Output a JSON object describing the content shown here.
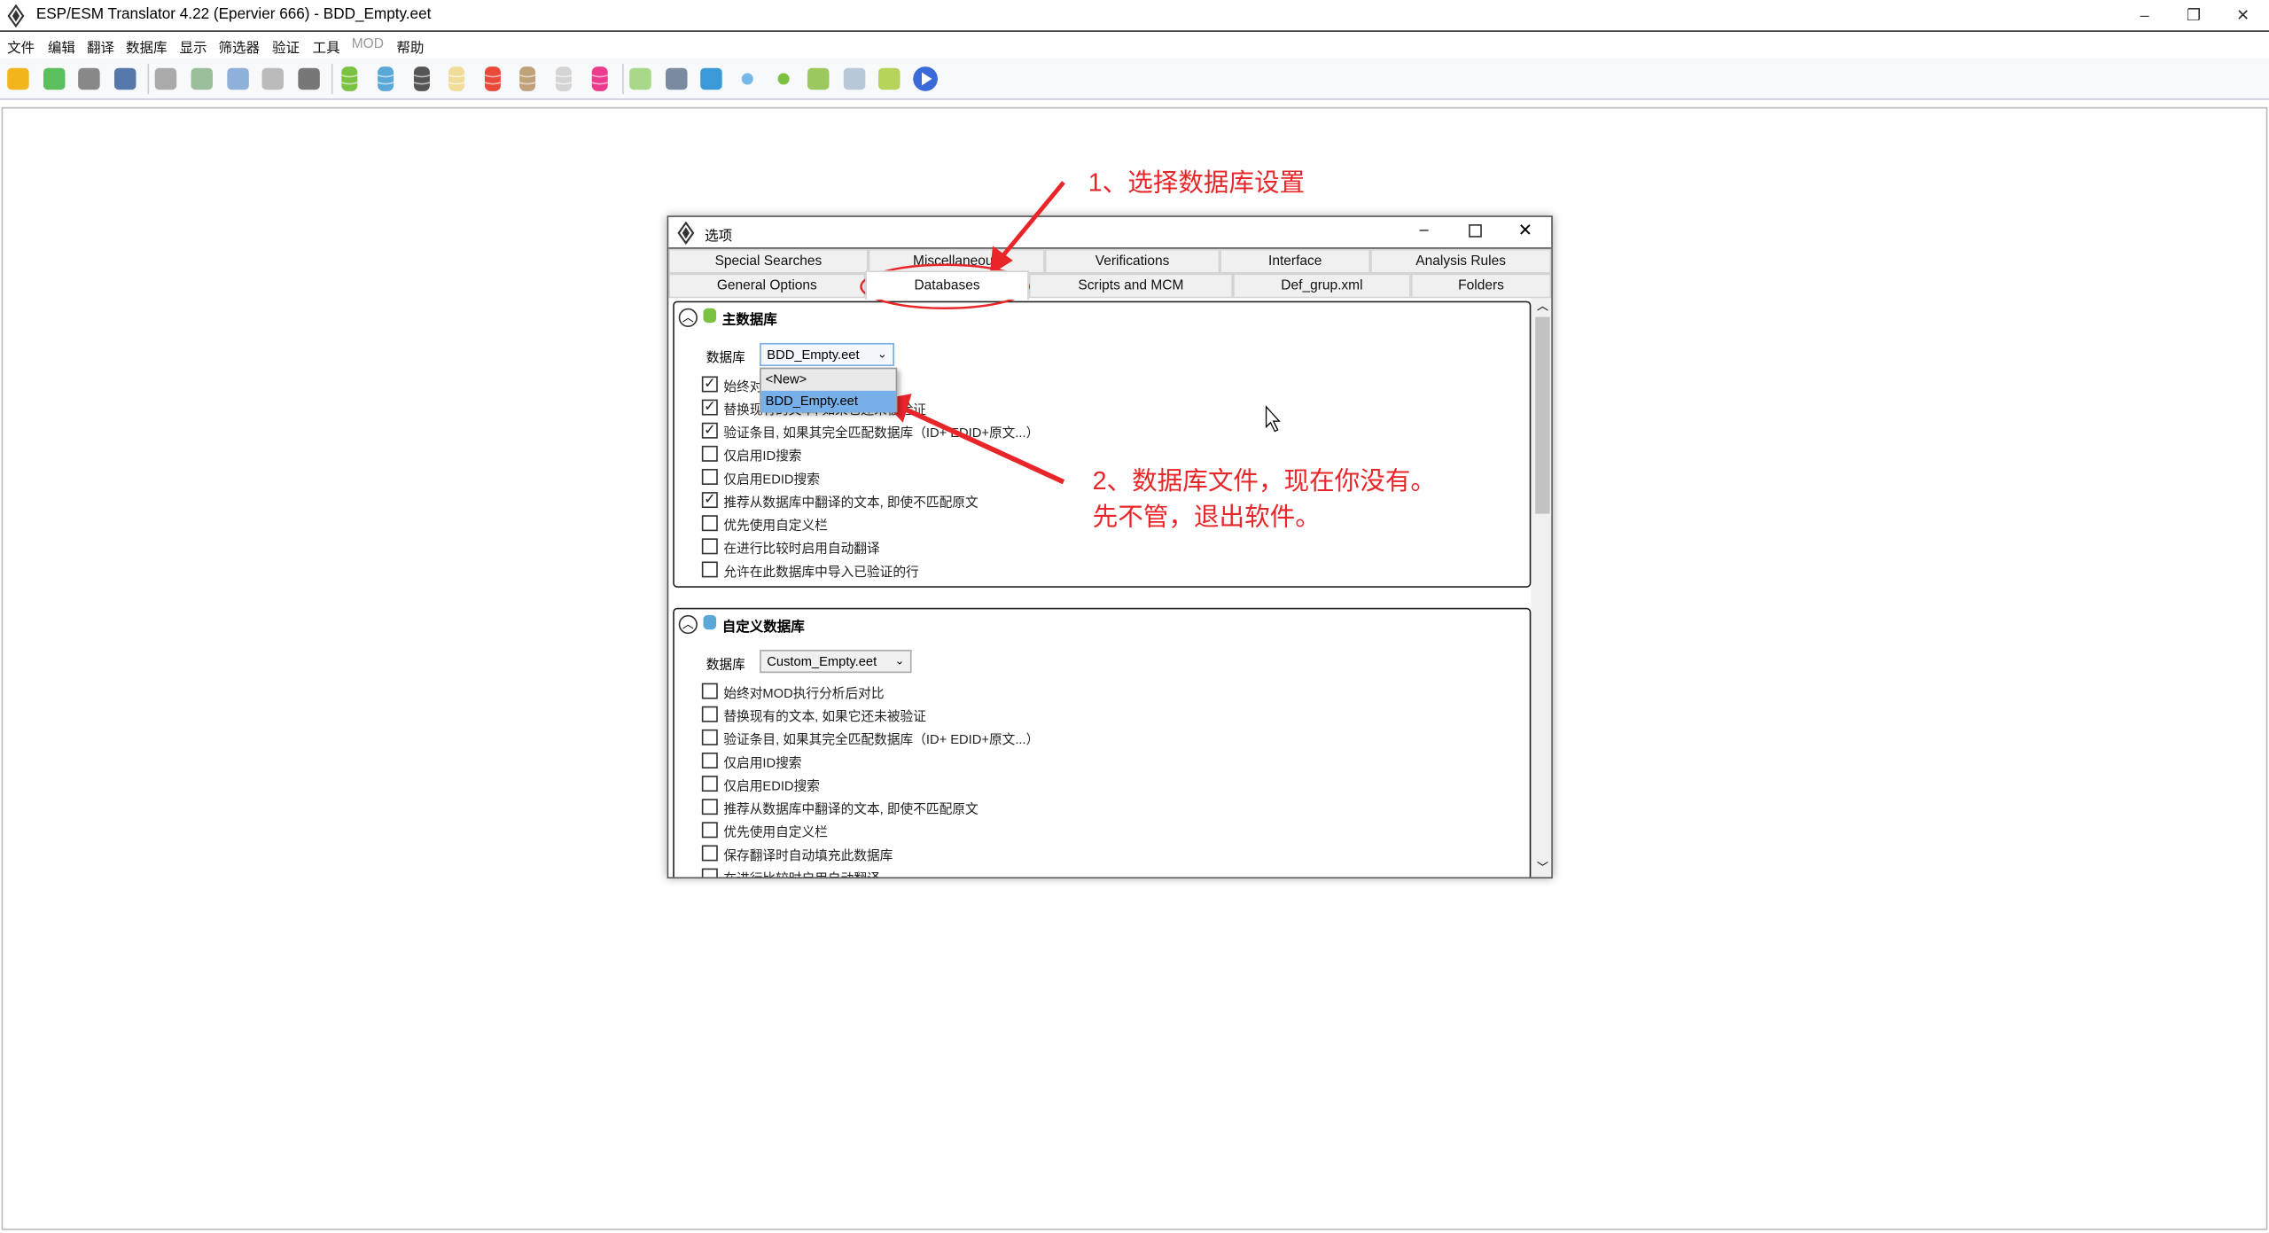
{
  "window": {
    "title": "ESP/ESM Translator 4.22 (Epervier 666) - BDD_Empty.eet",
    "controls": [
      "–",
      "❐",
      "✕"
    ]
  },
  "menu": [
    "文件",
    "编辑",
    "翻译",
    "数据库",
    "显示",
    "筛选器",
    "验证",
    "工具",
    "MOD",
    "帮助"
  ],
  "toolbar": [
    {
      "name": "open-folder-icon",
      "color": "#f2b51c"
    },
    {
      "name": "go-icon",
      "color": "#5bbf5b"
    },
    {
      "name": "gear-icon",
      "color": "#888888"
    },
    {
      "name": "edit-grid-icon",
      "color": "#5577aa"
    },
    {
      "sep": true
    },
    {
      "name": "search-icon",
      "color": "#aaaaaa"
    },
    {
      "name": "import-icon",
      "color": "#9bbf9b"
    },
    {
      "name": "export-icon",
      "color": "#8fb0d8"
    },
    {
      "name": "db-upload-icon",
      "color": "#bbbbbb"
    },
    {
      "name": "db-add-icon",
      "color": "#777777"
    },
    {
      "sep": true
    },
    {
      "name": "db-green-icon",
      "color": "#7cc242",
      "db": true
    },
    {
      "name": "db-blue-icon",
      "color": "#5aa8d8",
      "db": true
    },
    {
      "name": "db-black-icon",
      "color": "#555555",
      "db": true
    },
    {
      "name": "db-cream-icon",
      "color": "#f2dc9a",
      "db": true
    },
    {
      "name": "db-red-icon",
      "color": "#ea4a3a",
      "db": true
    },
    {
      "name": "db-tan-icon",
      "color": "#bfa27a",
      "db": true
    },
    {
      "name": "db-gray-icon",
      "color": "#d4d4d4",
      "db": true
    },
    {
      "name": "db-pink-icon",
      "color": "#ec3a8c",
      "db": true
    },
    {
      "sep": true
    },
    {
      "name": "script-icon",
      "color": "#a8d88a"
    },
    {
      "name": "wizard-icon",
      "color": "#7a8aa0"
    },
    {
      "name": "spellcheck-icon",
      "color": "#3a9ad8"
    },
    {
      "name": "dot-blue-icon",
      "color": "#77b8ea",
      "dot": true
    },
    {
      "name": "dot-green-icon",
      "color": "#7cc242",
      "dot": true
    },
    {
      "name": "xml-icon",
      "color": "#9cc860"
    },
    {
      "name": "book-icon",
      "color": "#b8c8d8"
    },
    {
      "name": "cube-icon",
      "color": "#b6d45a"
    },
    {
      "name": "play-icon",
      "color": "#3a6ad8",
      "round": true
    }
  ],
  "dialog": {
    "title": "选项",
    "tabs_row1": [
      "Special Searches",
      "Miscellaneous",
      "Verifications",
      "Interface",
      "Analysis Rules"
    ],
    "tabs_row2": [
      "General Options",
      "Databases",
      "Scripts and MCM",
      "Def_grup.xml",
      "Folders"
    ],
    "selected_tab": "Databases",
    "main_db": {
      "title": "主数据库",
      "db_label": "数据库",
      "value": "BDD_Empty.eet",
      "dropdown_options": [
        "<New>",
        "BDD_Empty.eet"
      ],
      "highlighted": "BDD_Empty.eet",
      "options": [
        {
          "label": "始终对MOD执行分析后对比",
          "checked": true
        },
        {
          "label": "替换现有的文本, 如果它还未被验证",
          "checked": true
        },
        {
          "label": "验证条目, 如果其完全匹配数据库（ID+ EDID+原文...）",
          "checked": true
        },
        {
          "label": "仅启用ID搜索",
          "checked": false
        },
        {
          "label": "仅启用EDID搜索",
          "checked": false
        },
        {
          "label": "推荐从数据库中翻译的文本, 即使不匹配原文",
          "checked": true
        },
        {
          "label": "优先使用自定义栏",
          "checked": false
        },
        {
          "label": "在进行比较时启用自动翻译",
          "checked": false
        },
        {
          "label": "允许在此数据库中导入已验证的行",
          "checked": false
        }
      ]
    },
    "custom_db": {
      "title": "自定义数据库",
      "db_label": "数据库",
      "value": "Custom_Empty.eet",
      "options": [
        {
          "label": "始终对MOD执行分析后对比",
          "checked": false
        },
        {
          "label": "替换现有的文本, 如果它还未被验证",
          "checked": false
        },
        {
          "label": "验证条目, 如果其完全匹配数据库（ID+ EDID+原文...）",
          "checked": false
        },
        {
          "label": "仅启用ID搜索",
          "checked": false
        },
        {
          "label": "仅启用EDID搜索",
          "checked": false
        },
        {
          "label": "推荐从数据库中翻译的文本, 即使不匹配原文",
          "checked": false
        },
        {
          "label": "优先使用自定义栏",
          "checked": false
        },
        {
          "label": "保存翻译时自动填充此数据库",
          "checked": false
        },
        {
          "label": "在进行比较时启用自动翻译",
          "checked": false
        }
      ]
    }
  },
  "annotations": {
    "step1": "1、选择数据库设置",
    "step2_line1": "2、数据库文件，现在你没有。",
    "step2_line2": "先不管，退出软件。",
    "color": "#e8262a"
  }
}
